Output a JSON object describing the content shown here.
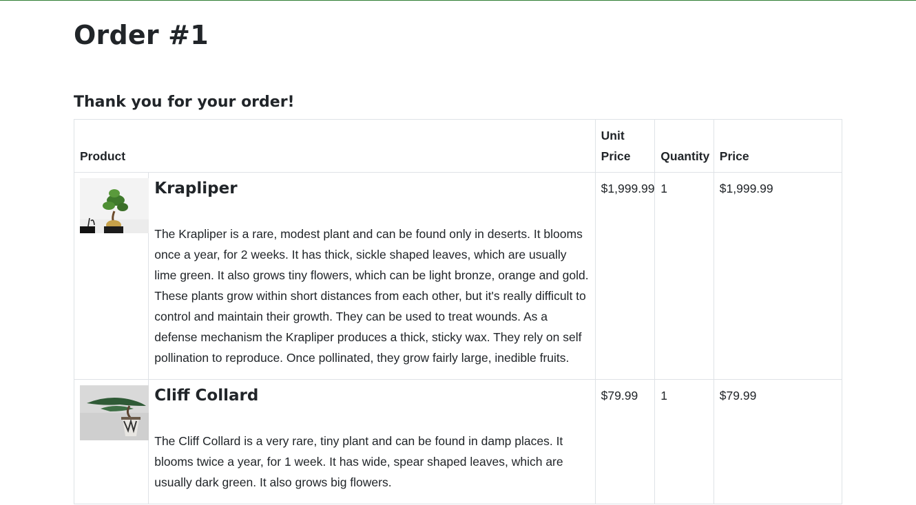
{
  "page": {
    "title": "Order #1",
    "subtitle": "Thank you for your order!",
    "accent_color": "#2e7d32"
  },
  "table": {
    "headers": {
      "product": "Product",
      "unit_price": "Unit Price",
      "quantity": "Quantity",
      "price": "Price"
    },
    "rows": [
      {
        "image_icon": "bonsai-plant-photo",
        "name": "Krapliper",
        "description": "The Krapliper is a rare, modest plant and can be found only in deserts. It blooms once a year, for 2 weeks. It has thick, sickle shaped leaves, which are usually lime green. It also grows tiny flowers, which can be light bronze, orange and gold. These plants grow within short distances from each other, but it's really difficult to control and maintain their growth. They can be used to treat wounds. As a defense mechanism the Krapliper produces a thick, sticky wax. They rely on self pollination to reproduce. Once pollinated, they grow fairly large, inedible fruits.",
        "unit_price": "$1,999.99",
        "quantity": "1",
        "price": "$1,999.99"
      },
      {
        "image_icon": "juniper-bonsai-photo",
        "name": "Cliff Collard",
        "description": "The Cliff Collard is a very rare, tiny plant and can be found in damp places. It blooms twice a year, for 1 week. It has wide, spear shaped leaves, which are usually dark green. It also grows big flowers.",
        "unit_price": "$79.99",
        "quantity": "1",
        "price": "$79.99"
      }
    ]
  }
}
